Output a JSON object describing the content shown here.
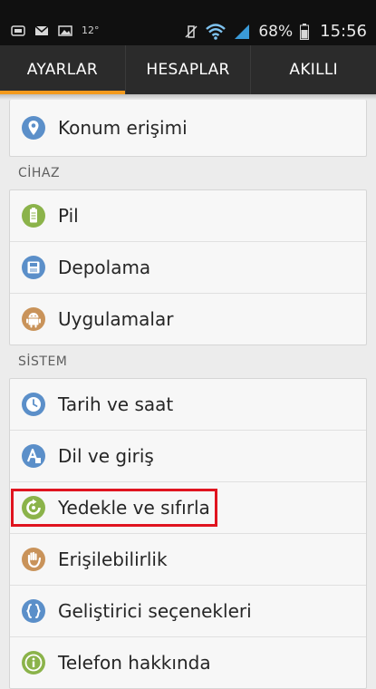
{
  "status_bar": {
    "left_icons": [
      "notification-icon",
      "mail-icon",
      "image-icon"
    ],
    "temperature": "12°",
    "battery_percent": "68%",
    "time": "15:56"
  },
  "tabs": [
    {
      "label": "AYARLAR",
      "active": true
    },
    {
      "label": "HESAPLAR",
      "active": false
    },
    {
      "label": "AKILLI",
      "active": false
    }
  ],
  "top_card": {
    "items": [
      {
        "label": "Konum erişimi",
        "icon": "location-icon"
      }
    ]
  },
  "sections": [
    {
      "header": "CİHAZ",
      "items": [
        {
          "label": "Pil",
          "icon": "battery-icon"
        },
        {
          "label": "Depolama",
          "icon": "storage-icon"
        },
        {
          "label": "Uygulamalar",
          "icon": "android-icon"
        }
      ]
    },
    {
      "header": "SİSTEM",
      "items": [
        {
          "label": "Tarih ve saat",
          "icon": "clock-icon"
        },
        {
          "label": "Dil ve giriş",
          "icon": "language-icon"
        },
        {
          "label": "Yedekle ve sıfırla",
          "icon": "backup-reset-icon",
          "highlighted": true
        },
        {
          "label": "Erişilebilirlik",
          "icon": "accessibility-hand-icon"
        },
        {
          "label": "Geliştirici seçenekleri",
          "icon": "developer-braces-icon"
        },
        {
          "label": "Telefon hakkında",
          "icon": "info-icon"
        }
      ]
    }
  ],
  "colors": {
    "accent": "#f39a1d",
    "highlight_border": "#e0141f",
    "icon_blue": "#5b8fc9",
    "icon_green": "#8bb34a",
    "icon_tan": "#c9935a"
  }
}
